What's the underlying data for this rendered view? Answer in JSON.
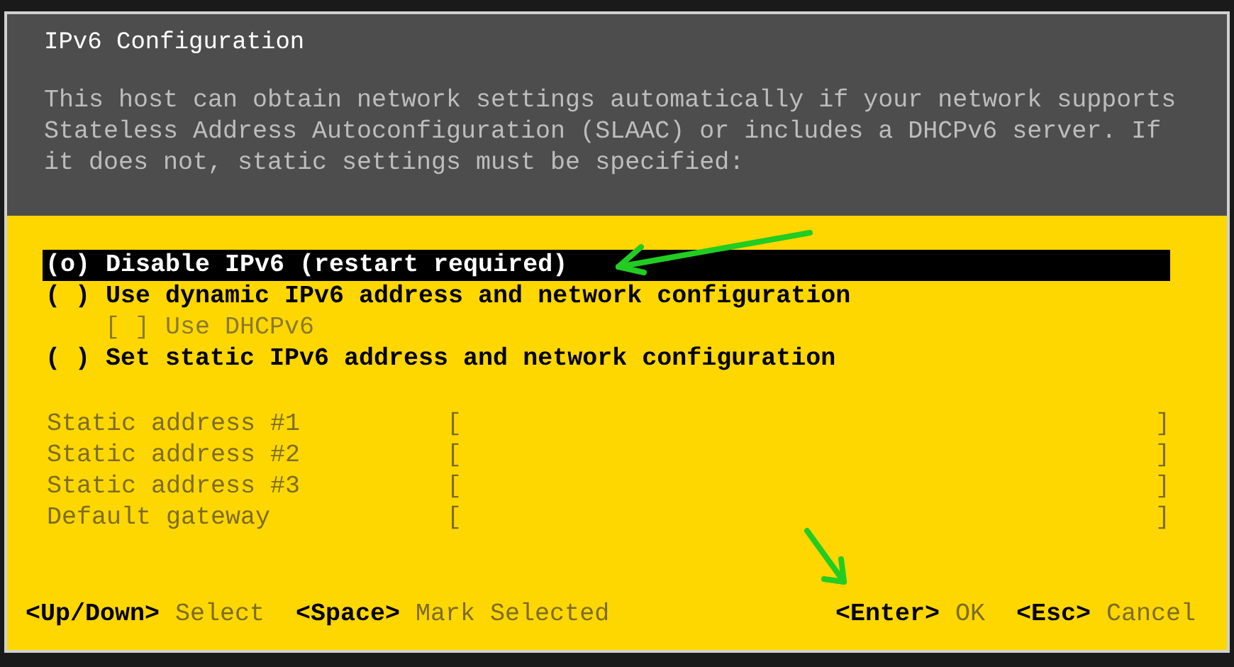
{
  "header": {
    "title": "IPv6 Configuration",
    "description": "This host can obtain network settings automatically if your network supports Stateless Address Autoconfiguration (SLAAC) or includes a DHCPv6 server. If it does not, static settings must be specified:"
  },
  "options": [
    {
      "kind": "radio",
      "marker": "(o)",
      "label": "Disable IPv6 (restart required)",
      "selected": true,
      "disabled": false
    },
    {
      "kind": "radio",
      "marker": "( )",
      "label": "Use dynamic IPv6 address and network configuration",
      "selected": false,
      "disabled": false
    },
    {
      "kind": "checkbox",
      "marker": "[ ]",
      "label": "Use DHCPv6",
      "selected": false,
      "disabled": true
    },
    {
      "kind": "radio",
      "marker": "( )",
      "label": "Set static IPv6 address and network configuration",
      "selected": false,
      "disabled": false
    }
  ],
  "fields": [
    {
      "label": "Static address #1",
      "open": "[",
      "close": "]"
    },
    {
      "label": "Static address #2",
      "open": "[",
      "close": "]"
    },
    {
      "label": "Static address #3",
      "open": "[",
      "close": "]"
    },
    {
      "label": "Default gateway",
      "open": "[",
      "close": "]"
    }
  ],
  "footer": {
    "left": [
      {
        "key": "<Up/Down>",
        "action": "Select"
      },
      {
        "key": "<Space>",
        "action": "Mark Selected"
      }
    ],
    "right": [
      {
        "key": "<Enter>",
        "action": "OK"
      },
      {
        "key": "<Esc>",
        "action": "Cancel"
      }
    ]
  }
}
